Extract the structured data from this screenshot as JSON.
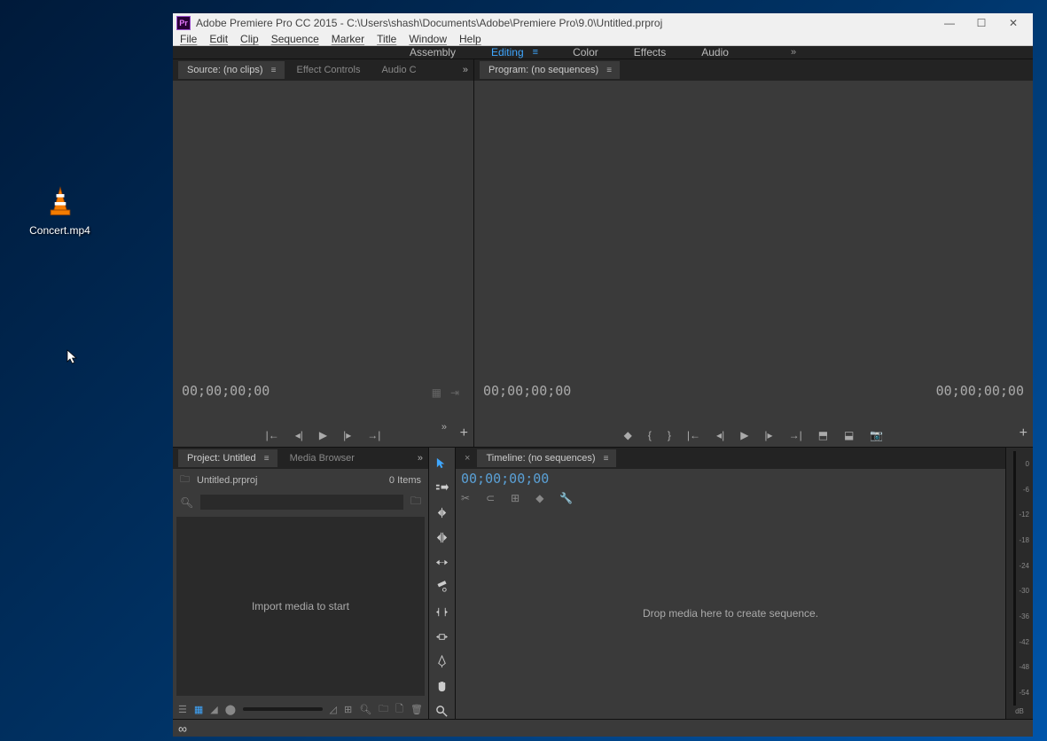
{
  "desktop": {
    "icon_label": "Concert.mp4"
  },
  "titlebar": {
    "app": "Pr",
    "title": "Adobe Premiere Pro CC 2015 - C:\\Users\\shash\\Documents\\Adobe\\Premiere Pro\\9.0\\Untitled.prproj"
  },
  "menubar": [
    "File",
    "Edit",
    "Clip",
    "Sequence",
    "Marker",
    "Title",
    "Window",
    "Help"
  ],
  "workspaces": [
    "Assembly",
    "Editing",
    "Color",
    "Effects",
    "Audio"
  ],
  "workspace_active": "Editing",
  "source": {
    "tab": "Source: (no clips)",
    "tab2": "Effect Controls",
    "tab3": "Audio C",
    "tc_left": "00;00;00;00"
  },
  "program": {
    "tab": "Program: (no sequences)",
    "tc_left": "00;00;00;00",
    "tc_right": "00;00;00;00"
  },
  "project": {
    "tab": "Project: Untitled",
    "tab2": "Media Browser",
    "filename": "Untitled.prproj",
    "item_count": "0 Items",
    "import_hint": "Import media to start"
  },
  "timeline": {
    "tab": "Timeline: (no sequences)",
    "tc": "00;00;00;00",
    "drop_hint": "Drop media here to create sequence."
  },
  "audio_meter": [
    "0",
    "-6",
    "-12",
    "-18",
    "-24",
    "-30",
    "-36",
    "-42",
    "-48",
    "-54"
  ],
  "audio_db": "dB"
}
